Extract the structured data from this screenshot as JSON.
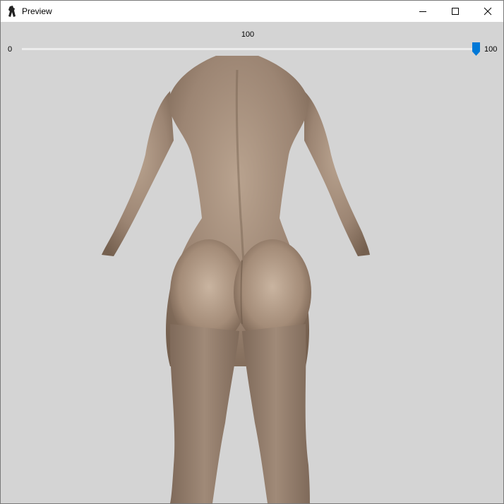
{
  "window": {
    "title": "Preview",
    "icon": "figure-silhouette-icon",
    "controls": [
      "minimize-icon",
      "maximize-icon",
      "close-icon"
    ]
  },
  "slider": {
    "value": 100,
    "value_label": "100",
    "min_label": "0",
    "max_label": "100",
    "min": 0,
    "max": 100,
    "accent_color": "#0078d7"
  },
  "viewport": {
    "background_color": "#d4d4d4",
    "content": "3d-body-model-back-view"
  }
}
